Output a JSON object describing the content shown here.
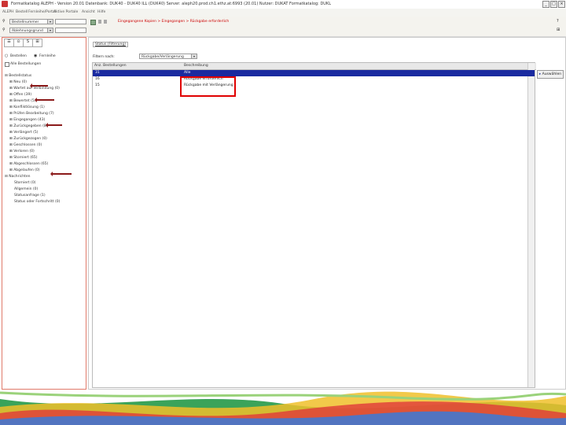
{
  "window": {
    "title": "Formatkatalog ALEPH - Version 20.01 Datenbank: DUK40 - DUK40 ILL (DUK40) Server: aleph20.prod.ch1.ethz.at:6993 (20.01) Nutzer: DUKAT Formatkatalog: DUKL"
  },
  "menu": [
    {
      "label": "ALEPH"
    },
    {
      "label": "Bestell"
    },
    {
      "label": "Fernleihe/Portal"
    },
    {
      "label": "Aktive Portale"
    },
    {
      "label": "Ansicht"
    },
    {
      "label": "Hilfe"
    }
  ],
  "toolbar": {
    "dropdown1": "Bestellnummer",
    "dropdown2": "Ablehnungsgrund",
    "breadcrumb": "Eingegangene Kopien > Eingegangen > Rückgabe erforderlich"
  },
  "left_panel": {
    "tabs": [
      "list",
      "tree",
      "S",
      "num"
    ],
    "radio1": "Bestellen",
    "radio2": "Fernleihe",
    "checkbox": "Alle Bestellungen",
    "tree": [
      {
        "label": "Bestellstatus",
        "level": 0,
        "expander": "⊟"
      },
      {
        "label": "Neu (0)",
        "level": 1,
        "expander": "⊞"
      },
      {
        "label": "Wartet auf Verbindung (0)",
        "level": 1,
        "expander": "⊞"
      },
      {
        "label": "Offen (39)",
        "level": 1,
        "expander": "⊞"
      },
      {
        "label": "Bewertet (5)",
        "level": 1,
        "expander": "⊞"
      },
      {
        "label": "Konfliktlösung (1)",
        "level": 1,
        "expander": "⊞"
      },
      {
        "label": "Prüfen Bearbeitung (7)",
        "level": 1,
        "expander": "⊞"
      },
      {
        "label": "Eingegangen (43)",
        "level": 1,
        "expander": "⊞"
      },
      {
        "label": "Zurückgegeben (8)",
        "level": 1,
        "expander": "⊞"
      },
      {
        "label": "Verlängert (5)",
        "level": 1,
        "expander": "⊞"
      },
      {
        "label": "Zurückgezogen (0)",
        "level": 1,
        "expander": "⊞"
      },
      {
        "label": "Geschlossen (0)",
        "level": 1,
        "expander": "⊞"
      },
      {
        "label": "Verloren (0)",
        "level": 1,
        "expander": "⊞"
      },
      {
        "label": "Storniert (65)",
        "level": 1,
        "expander": "⊞"
      },
      {
        "label": "Abgeschlossen (65)",
        "level": 1,
        "expander": "⊞"
      },
      {
        "label": "Abgelaufen (0)",
        "level": 1,
        "expander": "⊞"
      },
      {
        "label": "Nachrichten",
        "level": 0,
        "expander": "⊟"
      },
      {
        "label": "Storniert (0)",
        "level": 2,
        "expander": ""
      },
      {
        "label": "Allgemein (0)",
        "level": 2,
        "expander": ""
      },
      {
        "label": "Statusanfrage (1)",
        "level": 2,
        "expander": ""
      },
      {
        "label": "Status oder Fortschritt (0)",
        "level": 2,
        "expander": ""
      }
    ]
  },
  "right_panel": {
    "tab": "Status (Filterung)",
    "filter_label": "Filtern nach:",
    "filter_value": "Rückgabe/Verlängerung",
    "columns": [
      "Anz. Bestellungen",
      "Beschreibung"
    ],
    "rows": [
      {
        "count": "31",
        "desc": "Alle",
        "selected": true
      },
      {
        "count": "16",
        "desc": "Rückgabe erforderlich",
        "selected": false
      },
      {
        "count": "15",
        "desc": "Rückgabe mit Verlängerung",
        "selected": false
      }
    ],
    "side_button": "Auswählen"
  },
  "colors": {
    "selection": "#1a2aa0",
    "highlight_box": "#e00000",
    "arrow": "#8b1a1a",
    "left_border": "#e07a6a"
  }
}
